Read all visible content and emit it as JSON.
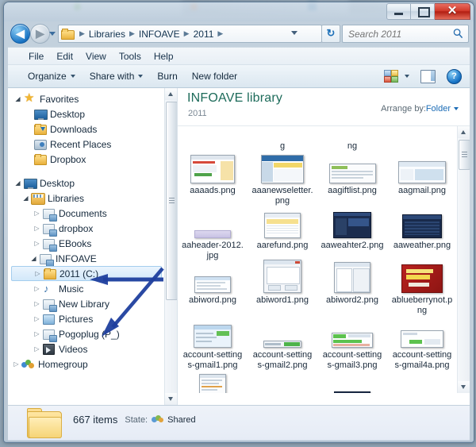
{
  "window": {
    "controls": {
      "minimize_label": "—",
      "maximize_label": "□",
      "close_label": "✕"
    }
  },
  "address_bar": {
    "back_label": "◀",
    "forward_label": "▶",
    "folder_icon": "folder-icon",
    "breadcrumbs": [
      "Libraries",
      "INFOAVE",
      "2011"
    ],
    "separator": "▶",
    "refresh_label": "↻",
    "history_dropdown": "chevron-down-icon"
  },
  "search": {
    "placeholder": "Search 2011",
    "value": "",
    "icon": "search-icon"
  },
  "menu_bar": {
    "items": [
      "File",
      "Edit",
      "View",
      "Tools",
      "Help"
    ]
  },
  "toolbar": {
    "organize_label": "Organize",
    "share_with_label": "Share with",
    "burn_label": "Burn",
    "new_folder_label": "New folder",
    "views_icon": "views-icon",
    "views_dropdown_icon": "chevron-down-icon",
    "preview_pane_icon": "preview-pane-icon",
    "help_icon": "help-icon",
    "help_label": "?"
  },
  "nav_pane": {
    "groups": [
      {
        "name": "favorites",
        "label": "Favorites",
        "icon": "star-icon",
        "toggle": "◢",
        "expanded": true,
        "children": [
          {
            "label": "Desktop",
            "icon": "monitor-icon",
            "toggle": ""
          },
          {
            "label": "Downloads",
            "icon": "downloads-folder-icon",
            "toggle": ""
          },
          {
            "label": "Recent Places",
            "icon": "recent-places-icon",
            "toggle": ""
          },
          {
            "label": "Dropbox",
            "icon": "folder-icon",
            "toggle": ""
          }
        ]
      },
      {
        "name": "desktop",
        "label": "Desktop",
        "icon": "monitor-icon",
        "toggle": "◢",
        "expanded": true,
        "children": [
          {
            "label": "Libraries",
            "icon": "libraries-icon",
            "toggle": "◢",
            "expanded": true,
            "children": [
              {
                "label": "Documents",
                "icon": "library-icon",
                "toggle": "▷"
              },
              {
                "label": "dropbox",
                "icon": "library-icon",
                "toggle": "▷"
              },
              {
                "label": "EBooks",
                "icon": "library-icon",
                "toggle": "▷"
              },
              {
                "label": "INFOAVE",
                "icon": "library-icon",
                "toggle": "◢",
                "expanded": true,
                "annotated": true
              },
              {
                "label": "2011 (C:)",
                "icon": "folder-icon",
                "toggle": "▷",
                "selected": true
              },
              {
                "label": "Music",
                "icon": "music-icon",
                "toggle": "▷"
              },
              {
                "label": "New Library",
                "icon": "library-icon",
                "toggle": "▷",
                "annotated": true
              },
              {
                "label": "Pictures",
                "icon": "pictures-icon",
                "toggle": "▷"
              },
              {
                "label": "Pogoplug (P_)",
                "icon": "library-icon",
                "toggle": "▷"
              },
              {
                "label": "Videos",
                "icon": "video-icon",
                "toggle": "▷"
              }
            ]
          }
        ]
      },
      {
        "name": "homegroup",
        "label": "Homegroup",
        "icon": "homegroup-icon",
        "toggle": "▷",
        "expanded": false,
        "children": []
      }
    ]
  },
  "library_header": {
    "title": "INFOAVE library",
    "subtitle": "2011",
    "arrange_by_label": "Arrange by:",
    "arrange_by_value": "Folder"
  },
  "file_grid": {
    "rows": [
      {
        "clipped": true,
        "cells": [
          {
            "name": "",
            "thumb": "none"
          },
          {
            "name": "g",
            "thumb": "none"
          },
          {
            "name": "ng",
            "thumb": "none"
          },
          {
            "name": "",
            "thumb": "none"
          }
        ]
      },
      {
        "cells": [
          {
            "name": "aaaads.png",
            "thumb": "webpage-light"
          },
          {
            "name": "aaanewseletter.png",
            "thumb": "newsletter-blue"
          },
          {
            "name": "aagiftlist.png",
            "thumb": "document-list"
          },
          {
            "name": "aagmail.png",
            "thumb": "webpage-pale"
          }
        ]
      },
      {
        "cells": [
          {
            "name": "aaheader-2012.jpg",
            "thumb": "lavender-bar"
          },
          {
            "name": "aarefund.png",
            "thumb": "spreadsheet"
          },
          {
            "name": "aaweahter2.png",
            "thumb": "dark-navy"
          },
          {
            "name": "aaweather.png",
            "thumb": "dark-navy2"
          }
        ]
      },
      {
        "cells": [
          {
            "name": "abiword.png",
            "thumb": "white-doc"
          },
          {
            "name": "abiword1.png",
            "thumb": "dialog-window"
          },
          {
            "name": "abiword2.png",
            "thumb": "dialog-window2"
          },
          {
            "name": "ablueberrynot.png",
            "thumb": "red-banner"
          }
        ]
      },
      {
        "cells": [
          {
            "name": "account-settings-gmail1.png",
            "thumb": "gmail-settings"
          },
          {
            "name": "account-settings-gmail2.png",
            "thumb": "thin-bar"
          },
          {
            "name": "account-settings-gmail3.png",
            "thumb": "green-rows"
          },
          {
            "name": "account-settings-gmail4a.png",
            "thumb": "green-row2"
          }
        ]
      },
      {
        "clipped_bottom": true,
        "cells": [
          {
            "name": "",
            "thumb": "tall-doc"
          },
          {
            "name": "",
            "thumb": "none"
          },
          {
            "name": "",
            "thumb": "dark-bar"
          },
          {
            "name": "",
            "thumb": "none"
          }
        ]
      }
    ]
  },
  "status_bar": {
    "item_count": "667 items",
    "state_label": "State:",
    "state_value": "Shared",
    "shared_icon": "people-icon",
    "folder_icon": "large-folder-icon"
  },
  "annotations": [
    {
      "name": "arrow-to-infoave",
      "target": "INFOAVE",
      "direction": "left"
    },
    {
      "name": "arrow-to-new-library",
      "target": "New Library",
      "direction": "down-left"
    }
  ],
  "colors": {
    "library_title": "#1d6b5a",
    "link": "#1a6bb5",
    "selection": "#d2e8fa",
    "annotation_arrow": "#1f3f9e",
    "close_button": "#d23b2c"
  }
}
